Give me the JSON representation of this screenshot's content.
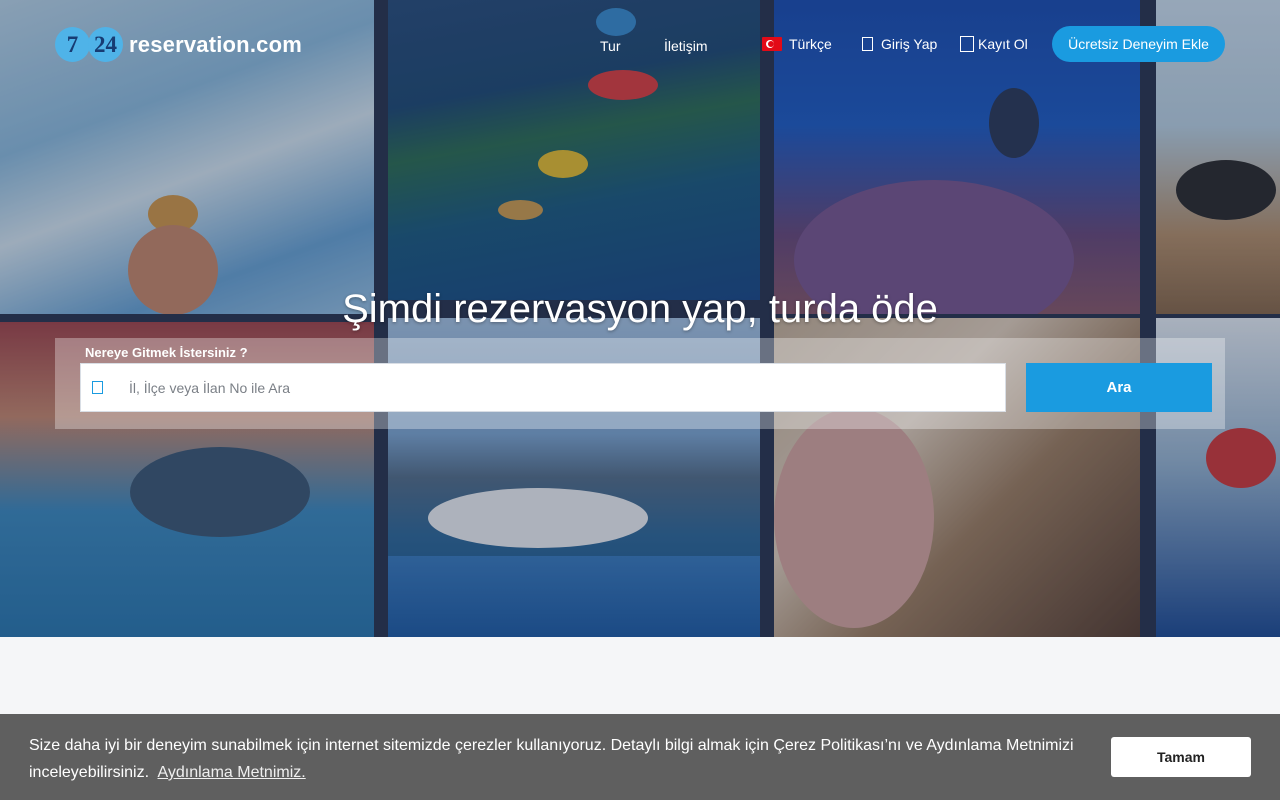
{
  "logo": {
    "digit_1": "7",
    "digit_2": "24",
    "text": "reservation.com"
  },
  "nav": {
    "tour": "Tur",
    "contact": "İletişim",
    "language": "Türkçe",
    "login": "Giriş Yap",
    "register": "Kayıt Ol",
    "cta": "Ücretsiz Deneyim Ekle"
  },
  "hero": {
    "headline": "Şimdi rezervasyon yap, turda öde",
    "search_label": "Nereye Gitmek İstersiniz ?",
    "search_placeholder": "İl, İlçe veya İlan No ile Ara",
    "search_value": "",
    "search_button": "Ara"
  },
  "cookie": {
    "message": "Size daha iyi bir deneyim sunabilmek için internet sitemizde çerezler kullanıyoruz. Detaylı bilgi almak için Çerez Politikası’nı ve Aydınlama Metnimizi inceleyebilirsiniz.",
    "link": "Aydınlama Metnimiz.",
    "accept": "Tamam"
  },
  "colors": {
    "accent": "#1a9be0",
    "cookie_bg": "#5f5f5f",
    "page_bg": "#f5f6f8"
  },
  "icons": {
    "flag": "turkey-flag-icon",
    "login": "login-icon",
    "register": "register-icon",
    "search": "location-pin-icon"
  }
}
